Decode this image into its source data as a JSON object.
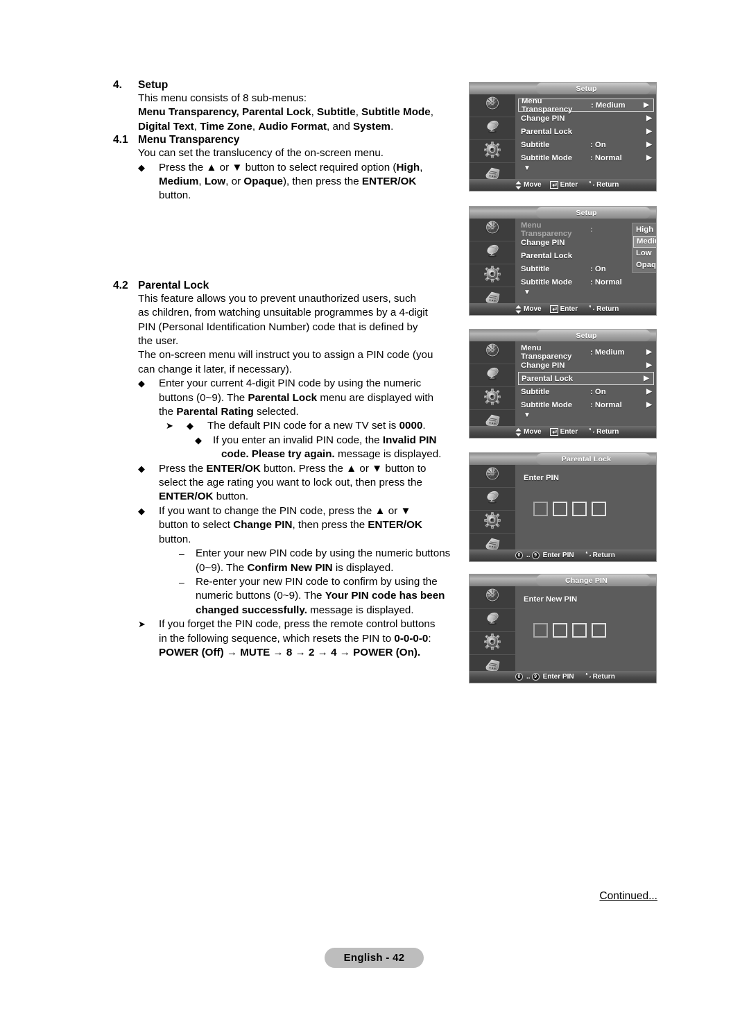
{
  "document": {
    "section4": {
      "num": "4.",
      "title": "Setup",
      "l1": "This menu consists of 8 sub-menus:",
      "l2_a": "Menu Transparency, Parental Lock",
      "l2_b": ", ",
      "l2_c": "Subtitle",
      "l2_d": ", ",
      "l2_e": "Subtitle Mode",
      "l2_f": ",",
      "l3_a": "Digital Text",
      "l3_b": ", ",
      "l3_c": "Time Zone",
      "l3_d": ", ",
      "l3_e": "Audio Format",
      "l3_f": ", and ",
      "l3_g": "System",
      "l3_h": "."
    },
    "section41": {
      "num": "4.1",
      "title": "Menu Transparency",
      "l1": "You can set the translucency of the on-screen menu.",
      "b1_l1_a": "Press the ",
      "b1_l1_b": "▲",
      "b1_l1_c": " or ",
      "b1_l1_d": "▼",
      "b1_l1_e": " button to select required option (",
      "b1_l1_f": "High",
      "b1_l1_g": ",",
      "b1_l2_a": "Medium",
      "b1_l2_b": ", ",
      "b1_l2_c": "Low",
      "b1_l2_d": ", or ",
      "b1_l2_e": "Opaque",
      "b1_l2_f": "), then press the ",
      "b1_l2_g": "ENTER/OK",
      "b1_l3": "button."
    },
    "section42": {
      "num": "4.2",
      "title": "Parental Lock",
      "p1_l1": "This feature allows you to prevent unauthorized users, such",
      "p1_l2": "as children, from watching unsuitable programmes by a 4-digit",
      "p1_l3": "PIN (Personal Identification Number) code that is defined by",
      "p1_l4": "the user.",
      "p2_l1": "The on-screen menu will instruct you to assign a PIN code (you",
      "p2_l2": "can change it later, if necessary).",
      "b1_l1": "Enter your current 4-digit PIN code by using the numeric",
      "b1_l2_a": "buttons (0~9). The ",
      "b1_l2_b": "Parental Lock",
      "b1_l2_c": " menu are displayed with",
      "b1_l3_a": "the ",
      "b1_l3_b": "Parental Rating",
      "b1_l3_c": " selected.",
      "n1_a": "The default PIN code for a new TV set is ",
      "n1_b": "0000",
      "n1_c": ".",
      "n2_l1_a": "If you enter an invalid PIN code, the ",
      "n2_l1_b": "Invalid PIN",
      "n2_l2_a": "code. Please try again.",
      "n2_l2_b": " message is displayed.",
      "b2_l1_a": "Press the ",
      "b2_l1_b": "ENTER/OK",
      "b2_l1_c": " button. Press the ",
      "b2_l1_d": "▲",
      "b2_l1_e": " or ",
      "b2_l1_f": "▼",
      "b2_l1_g": " button to",
      "b2_l2": "select the age rating you want to lock out, then press the",
      "b2_l3_a": "ENTER/OK",
      "b2_l3_b": " button.",
      "b3_l1_a": "If you want to change the PIN code, press the ",
      "b3_l1_b": "▲",
      "b3_l1_c": " or ",
      "b3_l1_d": "▼",
      "b3_l2_a": "button to select ",
      "b3_l2_b": "Change PIN",
      "b3_l2_c": ", then press the ",
      "b3_l2_d": "ENTER/OK",
      "b3_l3": "button.",
      "d1_l1": "Enter your new PIN code by using the numeric buttons",
      "d1_l2_a": "(0~9). The ",
      "d1_l2_b": "Confirm New PIN",
      "d1_l2_c": " is displayed.",
      "d2_l1": "Re-enter your new PIN code to confirm by using the",
      "d2_l2_a": "numeric buttons (0~9). The ",
      "d2_l2_b": "Your PIN code has been",
      "d2_l3_a": "changed successfully.",
      "d2_l3_b": " message is displayed.",
      "n3_l1": "If you forget the PIN code, press the remote control buttons",
      "n3_l2_a": "in the following sequence, which resets the PIN to ",
      "n3_l2_b": "0-0-0-0",
      "n3_l2_c": ":",
      "n3_l3": "POWER (Off) → MUTE → 8 → 2 → 4 → POWER (On)."
    },
    "continued": "Continued...",
    "page_label": "English - 42"
  },
  "osd_common": {
    "footer_move": "Move",
    "footer_enter": "Enter",
    "footer_return": "Return",
    "footer_enter_pin": "Enter PIN",
    "pin_key_low": "0",
    "pin_key_high": "9",
    "pin_key_sep": "..",
    "arrow_right": "▶",
    "arrow_down": "▼",
    "arrow_updown": "⬍",
    "return_icon": "↺",
    "icons": [
      "picture-icon",
      "satellite-dish-icon",
      "gear-icon",
      "remote-control-icon"
    ],
    "colors": {
      "panel_bg": "#5c5c5c",
      "sidebar_bg": "#3d3d3d",
      "title_pill": "#b4b4b4",
      "highlight_border": "#d8d8d8",
      "text": "#ffffff"
    }
  },
  "osd_panels": [
    {
      "id": "setup-menu-default",
      "title": "Setup",
      "rows": [
        {
          "label": "Menu Transparency",
          "value": ": Medium",
          "arrow": true,
          "selected": true
        },
        {
          "label": "Change PIN",
          "value": "",
          "arrow": true,
          "selected": false
        },
        {
          "label": "Parental Lock",
          "value": "",
          "arrow": true,
          "selected": false
        },
        {
          "label": "Subtitle",
          "value": ": On",
          "arrow": true,
          "selected": false
        },
        {
          "label": "Subtitle Mode",
          "value": ": Normal",
          "arrow": true,
          "selected": false
        }
      ],
      "more_indicator": "▼",
      "footer": "nav"
    },
    {
      "id": "setup-menu-transparency-open",
      "title": "Setup",
      "rows": [
        {
          "label": "Menu Transparency",
          "value": ":",
          "arrow": false,
          "selected": false,
          "dim": true
        },
        {
          "label": "Change PIN",
          "value": "",
          "arrow": false,
          "selected": false
        },
        {
          "label": "Parental Lock",
          "value": "",
          "arrow": false,
          "selected": false
        },
        {
          "label": "Subtitle",
          "value": ": On",
          "arrow": false,
          "selected": false
        },
        {
          "label": "Subtitle Mode",
          "value": ": Normal",
          "arrow": false,
          "selected": false
        }
      ],
      "more_indicator": "▼",
      "dropdown": {
        "options": [
          "High",
          "Medium",
          "Low",
          "Opaque"
        ],
        "selected": "Medium"
      },
      "footer": "nav"
    },
    {
      "id": "setup-menu-parental-lock-selected",
      "title": "Setup",
      "rows": [
        {
          "label": "Menu Transparency",
          "value": ": Medium",
          "arrow": true,
          "selected": false
        },
        {
          "label": "Change PIN",
          "value": "",
          "arrow": true,
          "selected": false
        },
        {
          "label": "Parental Lock",
          "value": "",
          "arrow": true,
          "selected": true
        },
        {
          "label": "Subtitle",
          "value": ": On",
          "arrow": true,
          "selected": false
        },
        {
          "label": "Subtitle Mode",
          "value": ": Normal",
          "arrow": true,
          "selected": false
        }
      ],
      "more_indicator": "▼",
      "footer": "nav"
    },
    {
      "id": "parental-lock-pin-entry",
      "title": "Parental Lock",
      "pin_prompt": "Enter PIN",
      "pin_digits": 4,
      "footer": "pin"
    },
    {
      "id": "change-pin-entry",
      "title": "Change PIN",
      "pin_prompt": "Enter New PIN",
      "pin_digits": 4,
      "footer": "pin"
    }
  ]
}
